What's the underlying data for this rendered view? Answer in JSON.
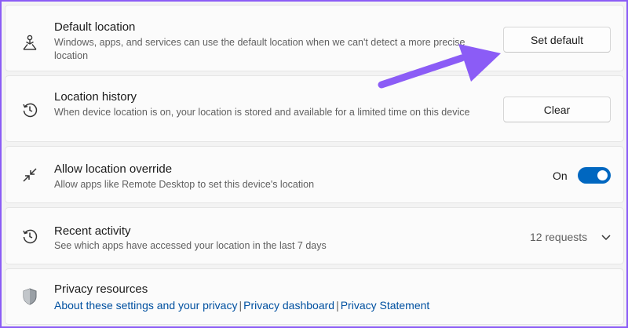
{
  "default_location": {
    "title": "Default location",
    "description": "Windows, apps, and services can use the default location when we can't detect a more precise location",
    "button": "Set default",
    "icon": "location-pin-person-icon"
  },
  "location_history": {
    "title": "Location history",
    "description": "When device location is on, your location is stored and available for a limited time on this device",
    "button": "Clear",
    "icon": "history-icon"
  },
  "location_override": {
    "title": "Allow location override",
    "description": "Allow apps like Remote Desktop to set this device's location",
    "toggle_label": "On",
    "toggle_state": true,
    "icon": "remote-arrows-icon"
  },
  "recent_activity": {
    "title": "Recent activity",
    "description": "See which apps have accessed your location in the last 7 days",
    "value": "12 requests",
    "icon": "history-icon"
  },
  "privacy_resources": {
    "title": "Privacy resources",
    "links": [
      "About these settings and your privacy",
      "Privacy dashboard",
      "Privacy Statement"
    ],
    "separator": "|",
    "icon": "shield-icon"
  },
  "colors": {
    "accent": "#0067c0",
    "annotation_arrow": "#8b5cf6",
    "link": "#0050a0"
  }
}
